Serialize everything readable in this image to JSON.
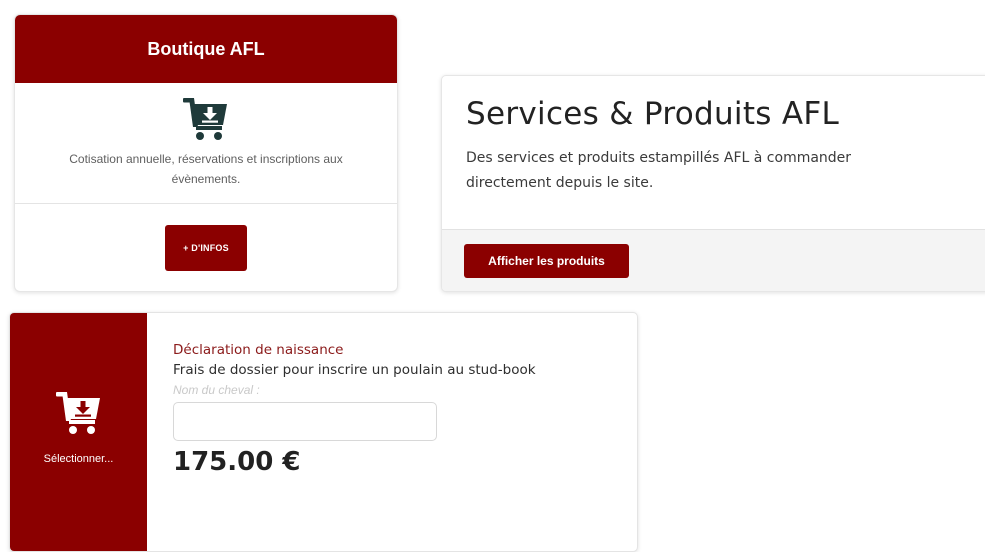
{
  "boutique": {
    "title": "Boutique AFL",
    "icon": "cart-download-icon",
    "description": "Cotisation annuelle, réservations et inscriptions aux évènements.",
    "button_label": "+ D'INFOS"
  },
  "services": {
    "title": "Services & Produits AFL",
    "description": "Des services et produits estampillés AFL à commander directement depuis le site.",
    "button_label": "Afficher les produits"
  },
  "declaration": {
    "icon": "cart-download-icon",
    "select_label": "Sélectionner...",
    "title": "Déclaration de naissance",
    "subtitle": "Frais de dossier pour inscrire un poulain au stud-book",
    "field_label": "Nom du cheval :",
    "field_value": "",
    "price": "175.00 €"
  },
  "colors": {
    "accent": "#8b0000",
    "title_red": "#8b1a1a"
  }
}
